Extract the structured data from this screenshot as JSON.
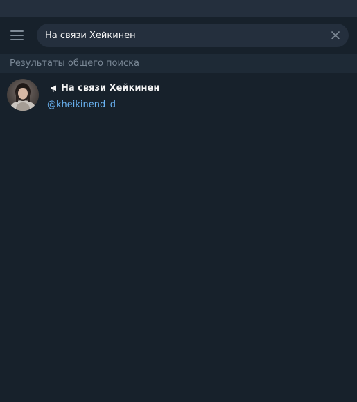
{
  "search": {
    "value": "На связи Хейкинен",
    "clear_icon": "close-icon"
  },
  "menu": {
    "icon": "hamburger-menu-icon"
  },
  "section": {
    "title": "Результаты общего поиска"
  },
  "results": [
    {
      "title": "На связи Хейкинен",
      "username": "@kheikinend_d",
      "type_icon": "megaphone-icon"
    }
  ],
  "colors": {
    "background": "#17212b",
    "search_bg": "#242f3d",
    "section_bg": "#1e2a36",
    "accent_link": "#6ab3f3",
    "muted_text": "#7a8896"
  }
}
